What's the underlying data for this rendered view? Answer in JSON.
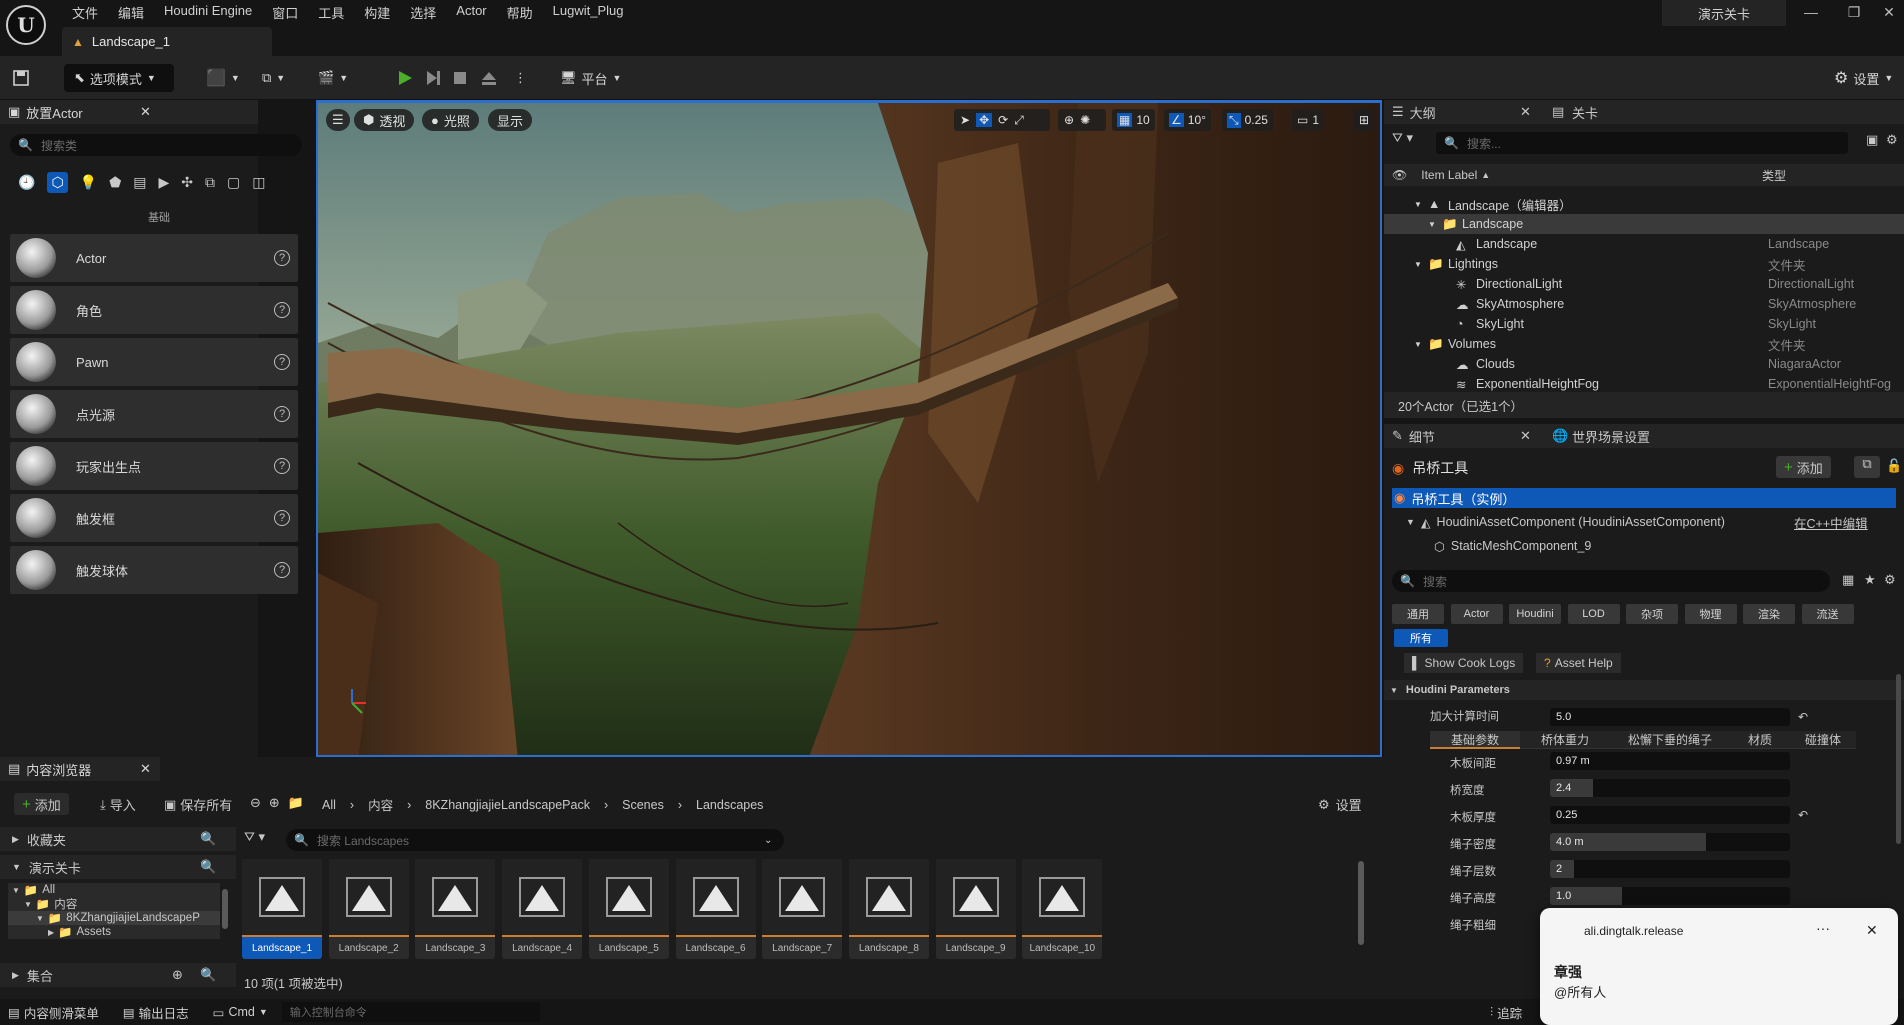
{
  "menu": [
    "文件",
    "编辑",
    "Houdini Engine",
    "窗口",
    "工具",
    "构建",
    "选择",
    "Actor",
    "帮助",
    "Lugwit_Plug"
  ],
  "project_name": "演示关卡",
  "doc_tab": "Landscape_1",
  "toolbar": {
    "mode_label": "选项模式",
    "platform_label": "平台",
    "settings_label": "设置"
  },
  "place_actor": {
    "title": "放置Actor",
    "search_placeholder": "搜索类",
    "category_label": "基础",
    "items": [
      "Actor",
      "角色",
      "Pawn",
      "点光源",
      "玩家出生点",
      "触发框",
      "触发球体"
    ]
  },
  "viewport": {
    "perspective_label": "透视",
    "lit_label": "光照",
    "show_label": "显示",
    "grid_value": "10",
    "angle_value": "10°",
    "scale_value": "0.25",
    "camera_speed": "1"
  },
  "outliner": {
    "tab_label": "大纲",
    "tab2_label": "关卡",
    "search_placeholder": "搜索...",
    "col_label": "Item Label",
    "col_type": "类型",
    "rows": [
      {
        "label": "Landscape（编辑器）",
        "type": ""
      },
      {
        "label": "Landscape",
        "type": ""
      },
      {
        "label": "Landscape",
        "type": "Landscape"
      },
      {
        "label": "Lightings",
        "type": "文件夹"
      },
      {
        "label": "DirectionalLight",
        "type": "DirectionalLight"
      },
      {
        "label": "SkyAtmosphere",
        "type": "SkyAtmosphere"
      },
      {
        "label": "SkyLight",
        "type": "SkyLight"
      },
      {
        "label": "Volumes",
        "type": "文件夹"
      },
      {
        "label": "Clouds",
        "type": "NiagaraActor"
      },
      {
        "label": "ExponentialHeightFog",
        "type": "ExponentialHeightFog"
      }
    ],
    "footer": "20个Actor（已选1个）"
  },
  "details": {
    "tab_label": "细节",
    "tab2_label": "世界场景设置",
    "object_name": "吊桥工具",
    "add_label": "添加",
    "instance_label": "吊桥工具（实例）",
    "component1": "HoudiniAssetComponent (HoudiniAssetComponent)",
    "edit_cpp": "在C++中编辑",
    "component2": "StaticMeshComponent_9",
    "search_placeholder": "搜索",
    "categories": [
      "通用",
      "Actor",
      "Houdini",
      "LOD",
      "杂项",
      "物理",
      "渲染",
      "流送"
    ],
    "all_label": "所有",
    "show_cook_logs": "Show Cook Logs",
    "asset_help": "Asset Help",
    "section_title": "Houdini Parameters",
    "max_cook_label": "加大计算时间",
    "max_cook_value": "5.0",
    "subtabs": [
      "基础参数",
      "桥体重力",
      "松懈下垂的绳子",
      "材质",
      "碰撞体"
    ],
    "params": [
      {
        "label": "木板间距",
        "value": "0.97 m",
        "fill": 0.0
      },
      {
        "label": "桥宽度",
        "value": "2.4",
        "fill": 0.18
      },
      {
        "label": "木板厚度",
        "value": "0.25",
        "fill": 0.0
      },
      {
        "label": "绳子密度",
        "value": "4.0 m",
        "fill": 0.65
      },
      {
        "label": "绳子层数",
        "value": "2",
        "fill": 0.1
      },
      {
        "label": "绳子高度",
        "value": "1.0",
        "fill": 0.3
      },
      {
        "label": "绳子粗细",
        "value": "",
        "fill": 0.0
      }
    ]
  },
  "content_browser": {
    "tab_label": "内容浏览器",
    "add_label": "添加",
    "import_label": "导入",
    "save_all_label": "保存所有",
    "breadcrumb": [
      "All",
      "内容",
      "8KZhangjiajieLandscapePack",
      "Scenes",
      "Landscapes"
    ],
    "settings_label": "设置",
    "favorites_label": "收藏夹",
    "project_label": "演示关卡",
    "tree": [
      "All",
      "内容",
      "8KZhangjiajieLandscapeP",
      "Assets"
    ],
    "collections_label": "集合",
    "search_placeholder": "搜索 Landscapes",
    "assets": [
      "Landscape_1",
      "Landscape_2",
      "Landscape_3",
      "Landscape_4",
      "Landscape_5",
      "Landscape_6",
      "Landscape_7",
      "Landscape_8",
      "Landscape_9",
      "Landscape_10"
    ],
    "status": "10 项(1 项被选中)"
  },
  "statusbar": {
    "drawer_label": "内容侧滑菜单",
    "log_label": "输出日志",
    "cmd_label": "Cmd",
    "console_placeholder": "输入控制台命令",
    "trace_label": "追踪"
  },
  "toast": {
    "app": "ali.dingtalk.release",
    "title": "章强",
    "body": "@所有人"
  },
  "colors": {
    "accent": "#0e58b8",
    "play": "#4caf2a",
    "bg": "#1b1b1b"
  }
}
